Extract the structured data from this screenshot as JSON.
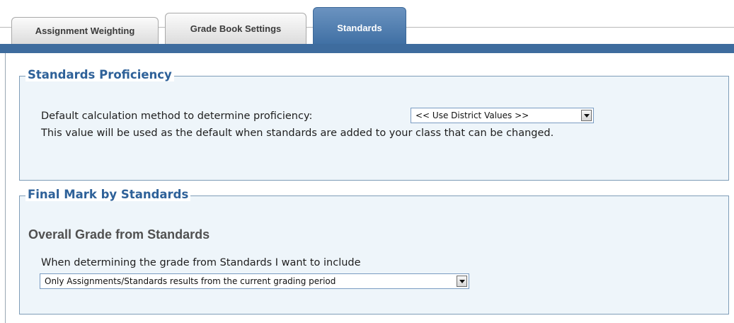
{
  "tabs": [
    {
      "label": "Assignment Weighting",
      "active": false
    },
    {
      "label": "Grade Book Settings",
      "active": false
    },
    {
      "label": "Standards",
      "active": true
    }
  ],
  "standards_proficiency": {
    "legend": "Standards Proficiency",
    "method_label": "Default calculation method to determine proficiency:",
    "method_select": {
      "selected": "<< Use District Values >>"
    },
    "note": "This value will be used as the default when standards are added to your class that can be changed."
  },
  "final_mark": {
    "legend": "Final Mark by Standards",
    "subheading": "Overall Grade from Standards",
    "include_label": "When determining the grade from Standards I want to include",
    "include_select": {
      "selected": "Only Assignments/Standards results from the current grading period"
    }
  },
  "colors": {
    "accent": "#3e6c9e",
    "legend_text": "#2e6199",
    "panel_bg": "#eef5fa"
  }
}
